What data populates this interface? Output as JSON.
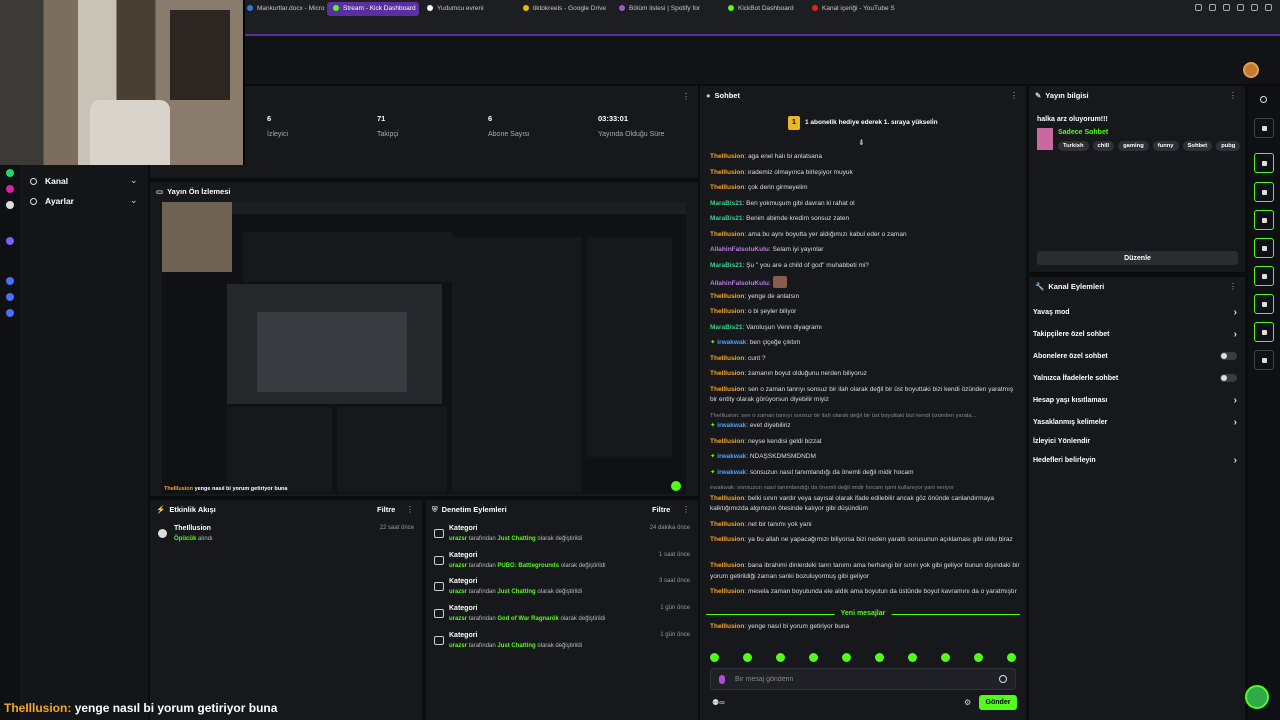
{
  "browser": {
    "tabs": [
      {
        "label": "Mankurtlar.docx - Micros",
        "color": "#2b78d6",
        "active": false
      },
      {
        "label": "Stream - Kick Dashboard",
        "color": "#53fc18",
        "active": true
      },
      {
        "label": "Yudumcu evreni",
        "color": "#ffffff",
        "active": false
      },
      {
        "label": "tiktokreels - Google Drive",
        "color": "#f4b400",
        "active": false
      },
      {
        "label": "Bölüm listesi | Spotify for",
        "color": "#9b59d6",
        "active": false
      },
      {
        "label": "KickBot Dashboard",
        "color": "#53fc18",
        "active": false
      },
      {
        "label": "Kanal içeriği - YouTube S",
        "color": "#e62117",
        "active": false
      }
    ]
  },
  "sidebar": {
    "items": [
      {
        "label": "Kanal",
        "icon": "globe-icon"
      },
      {
        "label": "Ayarlar",
        "icon": "gear-icon"
      }
    ]
  },
  "stats": [
    {
      "value": "6",
      "label": "İzleyici"
    },
    {
      "value": "71",
      "label": "Takipçi"
    },
    {
      "value": "6",
      "label": "Abone Sayısı"
    },
    {
      "value": "03:33:01",
      "label": "Yayında Olduğu Süre"
    }
  ],
  "preview": {
    "title": "Yayın Ön İzlemesi",
    "caption_user": "TheIllusion",
    "caption_text": "yenge nasıl bi yorum getiriyor buna"
  },
  "activity": {
    "title": "Etkinlik Akışı",
    "filter": "Filtre",
    "items": [
      {
        "user": "TheIllusion",
        "detail": "Öpücük",
        "detail2": "alındı",
        "time": "22 saat önce"
      }
    ]
  },
  "audit": {
    "title": "Denetim Eylemleri",
    "filter": "Filtre",
    "items": [
      {
        "title": "Kategori",
        "user": "urazsr",
        "mid": "tarafından",
        "target": "Just Chatting",
        "end": "olarak değiştirildi",
        "time": "24 dakika önce"
      },
      {
        "title": "Kategori",
        "user": "urazsr",
        "mid": "tarafından",
        "target": "PUBG: Battlegrounds",
        "end": "olarak değiştirildi",
        "time": "1 saat önce"
      },
      {
        "title": "Kategori",
        "user": "urazsr",
        "mid": "tarafından",
        "target": "Just Chatting",
        "end": "olarak değiştirildi",
        "time": "3 saat önce"
      },
      {
        "title": "Kategori",
        "user": "urazsr",
        "mid": "tarafından",
        "target": "God of War Ragnarök",
        "end": "olarak değiştirildi",
        "time": "1 gün önce"
      },
      {
        "title": "Kategori",
        "user": "urazsr",
        "mid": "tarafından",
        "target": "Just Chatting",
        "end": "olarak değiştirildi",
        "time": "1 gün önce"
      }
    ]
  },
  "chat": {
    "title": "Sohbet",
    "banner": "1 abonelik hediye ederek 1. sıraya yükseli̇n",
    "new_messages": "Yeni mesajlar",
    "input_placeholder": "Bir mesaj gönderin",
    "send_label": "Gönder",
    "messages": [
      {
        "user": "TheIllusion",
        "color": "#f5a623",
        "text": "aga enel halı bi anlatsana",
        "lines": 1
      },
      {
        "user": "TheIllusion",
        "color": "#f5a623",
        "text": "irademiz olmayınca birleşiyor muyuk",
        "lines": 1
      },
      {
        "user": "TheIllusion",
        "color": "#f5a623",
        "text": "çok derin girmeyelim",
        "lines": 1
      },
      {
        "user": "MaraBis21",
        "color": "#3ecf8e",
        "text": "Ben yokmuşum gibi davran ki rahat ol",
        "lines": 1
      },
      {
        "user": "MaraBis21",
        "color": "#3ecf8e",
        "text": "Benim abimde kredim sonsuz zaten",
        "lines": 1
      },
      {
        "user": "TheIllusion",
        "color": "#f5a623",
        "text": "ama bu aynı boyutta yer aldığımızı kabul eder o zaman",
        "lines": 1
      },
      {
        "user": "AllahinFalsoluKulu",
        "color": "#b57be8",
        "text": "Selam iyi yayınlar",
        "lines": 1
      },
      {
        "user": "MaraBis21",
        "color": "#3ecf8e",
        "text": "Şu \" you are a child of god\" muhabbeti mi?",
        "lines": 1
      },
      {
        "user": "AllahinFalsoluKulu",
        "color": "#b57be8",
        "text": "",
        "lines": 1
      },
      {
        "user": "TheIllusion",
        "color": "#f5a623",
        "text": "yenge de anlatsın",
        "lines": 1
      },
      {
        "user": "TheIllusion",
        "color": "#f5a623",
        "text": "o bi şeyler biliyor",
        "lines": 1
      },
      {
        "user": "MaraBis21",
        "color": "#3ecf8e",
        "text": "Varoluşun Venn diyagramı",
        "lines": 1
      },
      {
        "user": "irwakwak",
        "color": "#4aa3ff",
        "text": "ben çiçeğe çıktım",
        "lines": 1
      },
      {
        "user": "TheIllusion",
        "color": "#f5a623",
        "text": "cunt ?",
        "lines": 1
      },
      {
        "user": "TheIllusion",
        "color": "#f5a623",
        "text": "zamanın boyut olduğunu nerden biliyoruz",
        "lines": 1
      },
      {
        "user": "TheIllusion",
        "color": "#f5a623",
        "text": "sen o zaman tanrıyı sonsuz bir ilah olarak değil bir üst boyuttaki bizi kendi özünden yaratmış bir entity olarak görüyorsun diyebilir miyiz",
        "lines": 2
      },
      {
        "reply": "TheIllusion: sen o zaman tanrıyı sonsuz bir ilah olarak değil bir üst boyuttaki bizi kendi özünden yarata...",
        "user": "irwakwak",
        "color": "#4aa3ff",
        "text": "evet diyebiliriz",
        "lines": 2
      },
      {
        "user": "TheIllusion",
        "color": "#f5a623",
        "text": "neyse kendisi geldi bizzat",
        "lines": 1
      },
      {
        "user": "irwakwak",
        "color": "#4aa3ff",
        "text": "NDAŞSKDMSMDNDM",
        "lines": 1
      },
      {
        "user": "irwakwak",
        "color": "#4aa3ff",
        "text": "sonsuzun nasıl tanımlandığı da önemli değil midir hocam",
        "lines": 1
      },
      {
        "reply": "irwakwak: sonsuzun nasıl tanımlandığı da önemli değil midir hocam işimi kullanıyor yani veriyor",
        "user": "TheIllusion",
        "color": "#f5a623",
        "text": "belki sınırı vardır veya sayısal olarak ifade edilebilir ancak göz önünde canlandırmaya kalktığımızda algımızın ötesinde kalıyor gibi düşündüm",
        "lines": 3
      },
      {
        "user": "TheIllusion",
        "color": "#f5a623",
        "text": "net bir tanımı yok yani",
        "lines": 1
      },
      {
        "user": "TheIllusion",
        "color": "#f5a623",
        "text": "ya bu allah ne yapacağımızı biliyorsa bizi neden yarattı sorusunun açıklaması gibi oldu biraz",
        "lines": 2
      },
      {
        "user": "TheIllusion",
        "color": "#f5a623",
        "text": "bana ibrahimi dinlerdeki tanrı tanımı ama herhangi bir sınırı yok gibi geliyor bunun dışındaki bir yorum getirildiği zaman sanki bozuluyormuş gibi geliyor",
        "lines": 2
      },
      {
        "user": "TheIllusion",
        "color": "#f5a623",
        "text": "mesela zaman boyutunda ele aldık ama boyutun da üstünde boyut kavramını da o yaratmıştır",
        "lines": 2
      }
    ],
    "last_message": {
      "user": "TheIllusion",
      "color": "#f5a623",
      "text": "yenge nasıl bi yorum getiriyor buna"
    }
  },
  "info": {
    "title": "Yayın bilgisi",
    "stream_title": "halka arz oluyorum!!!",
    "category": "Sadece Sohbet",
    "tags": [
      "Turkish",
      "chill",
      "gaming",
      "funny",
      "Sohbet",
      "pubg"
    ],
    "edit_label": "Düzenle"
  },
  "actions": {
    "title": "Kanal Eylemleri",
    "items": [
      {
        "label": "Yavaş mod",
        "control": "chevron"
      },
      {
        "label": "Takipçilere özel sohbet",
        "control": "chevron"
      },
      {
        "label": "Abonelere özel sohbet",
        "control": "toggle"
      },
      {
        "label": "Yalnızca İfadelerle sohbet",
        "control": "toggle"
      },
      {
        "label": "Hesap yaşı kısıtlaması",
        "control": "chevron"
      },
      {
        "label": "Yasaklanmış kelimeler",
        "control": "chevron"
      },
      {
        "label": "İzleyici Yönlendir",
        "control": "none"
      },
      {
        "label": "Hedefleri belirleyin",
        "control": "chevron"
      }
    ]
  },
  "overlay": {
    "user": "TheIllusion:",
    "text": "yenge nasıl bi yorum getiriyor buna"
  },
  "colors": {
    "accent": "#53fc18",
    "tab_active": "#5b2fa0"
  }
}
